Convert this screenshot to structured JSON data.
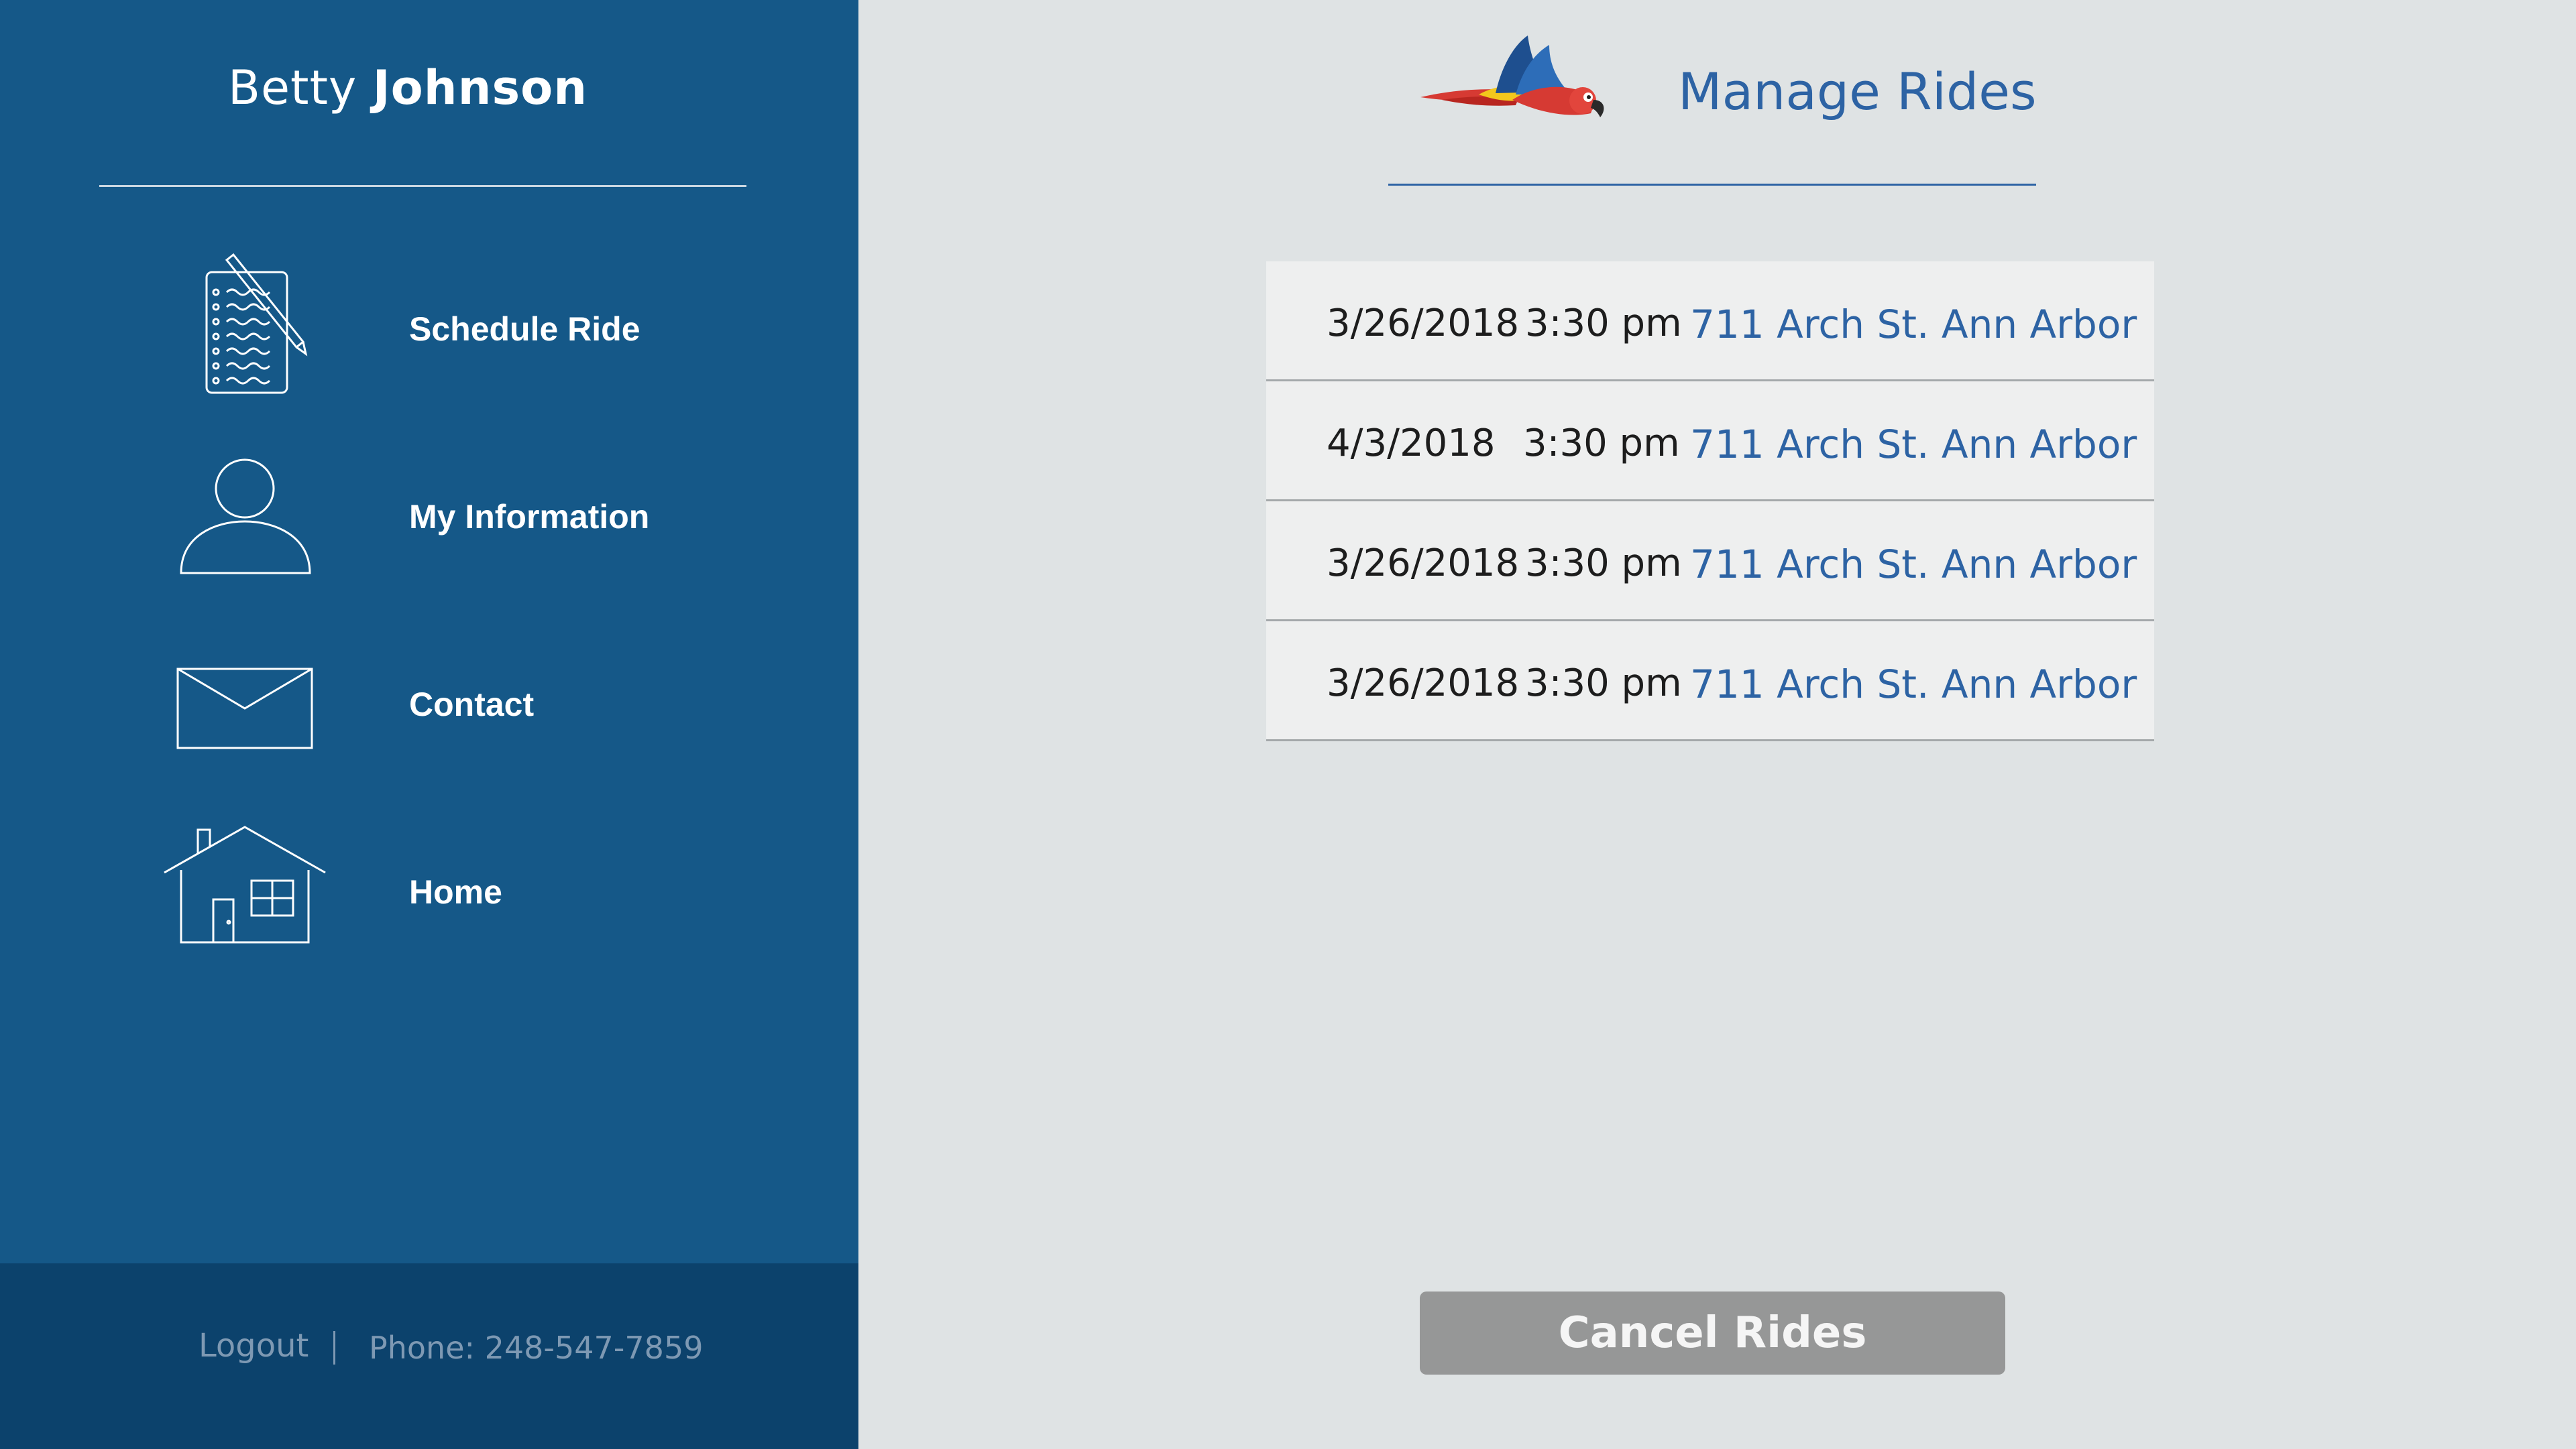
{
  "user": {
    "first_name": "Betty",
    "last_name": "Johnson"
  },
  "nav": [
    {
      "label": "Schedule Ride",
      "icon": "clipboard-pencil-icon"
    },
    {
      "label": "My Information",
      "icon": "person-icon"
    },
    {
      "label": "Contact",
      "icon": "envelope-icon"
    },
    {
      "label": "Home",
      "icon": "house-icon"
    }
  ],
  "footer": {
    "logout_label": "Logout",
    "separator": "|",
    "phone": "Phone: 248-547-7859"
  },
  "header": {
    "title": "Manage Rides",
    "logo_icon": "parrot-logo-icon"
  },
  "rides": [
    {
      "date": "3/26/2018",
      "time": "3:30 pm",
      "address": "711 Arch St. Ann Arbor"
    },
    {
      "date": "4/3/2018",
      "time": "3:30 pm",
      "address": "711 Arch St. Ann Arbor"
    },
    {
      "date": "3/26/2018",
      "time": "3:30 pm",
      "address": "711 Arch St. Ann Arbor"
    },
    {
      "date": "3/26/2018",
      "time": "3:30 pm",
      "address": "711 Arch St. Ann Arbor"
    }
  ],
  "actions": {
    "cancel_label": "Cancel Rides"
  },
  "colors": {
    "sidebar": "#155888",
    "footer": "#0c426c",
    "accent": "#2d63a4",
    "background": "#dfe3e4",
    "button": "#969797"
  }
}
